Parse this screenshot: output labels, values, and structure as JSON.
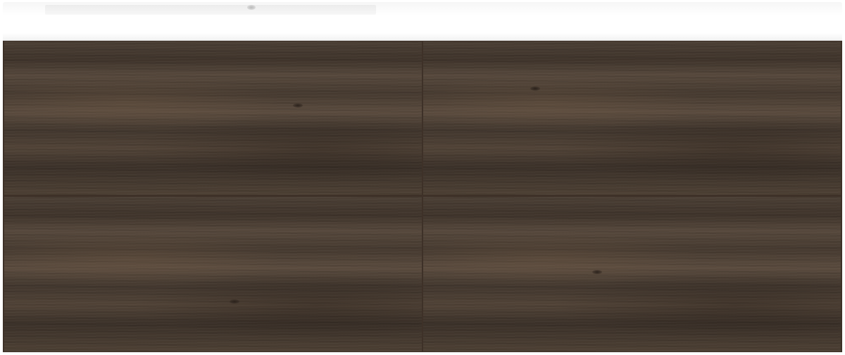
{
  "scene": {
    "subject": "bathroom-vanity",
    "sink_top_color": "#ffffff",
    "cabinet_color": "#4a3d33",
    "finish": "dark-oak-wood",
    "drawer_count": 4
  }
}
